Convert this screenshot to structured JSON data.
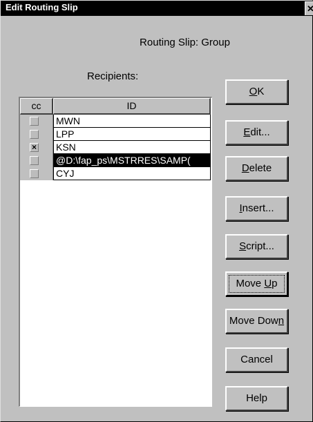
{
  "window": {
    "title": "Edit Routing Slip",
    "close_glyph": "✕"
  },
  "dialog": {
    "heading": "Routing Slip: Group",
    "recipients_label": "Recipients:"
  },
  "list": {
    "columns": [
      "cc",
      "ID"
    ],
    "rows": [
      {
        "cc": false,
        "id": "MWN",
        "selected": false
      },
      {
        "cc": false,
        "id": "LPP",
        "selected": false
      },
      {
        "cc": true,
        "id": "KSN",
        "selected": false
      },
      {
        "cc": false,
        "id": "@D:\\fap_ps\\MSTRRES\\SAMP(",
        "selected": true
      },
      {
        "cc": false,
        "id": "CYJ",
        "selected": false
      }
    ]
  },
  "buttons": [
    {
      "name": "ok-button",
      "pre": "",
      "mn": "O",
      "post": "K"
    },
    {
      "name": "edit-button",
      "pre": "",
      "mn": "E",
      "post": "dit..."
    },
    {
      "name": "delete-button",
      "pre": "",
      "mn": "D",
      "post": "elete"
    },
    {
      "name": "insert-button",
      "pre": "",
      "mn": "I",
      "post": "nsert..."
    },
    {
      "name": "script-button",
      "pre": "",
      "mn": "S",
      "post": "cript..."
    },
    {
      "name": "move-up-button",
      "pre": "Move ",
      "mn": "U",
      "post": "p"
    },
    {
      "name": "move-down-button",
      "pre": "Move Dow",
      "mn": "n",
      "post": ""
    },
    {
      "name": "cancel-button",
      "pre": "Cancel",
      "mn": "",
      "post": ""
    },
    {
      "name": "help-button",
      "pre": "Help",
      "mn": "",
      "post": ""
    }
  ]
}
